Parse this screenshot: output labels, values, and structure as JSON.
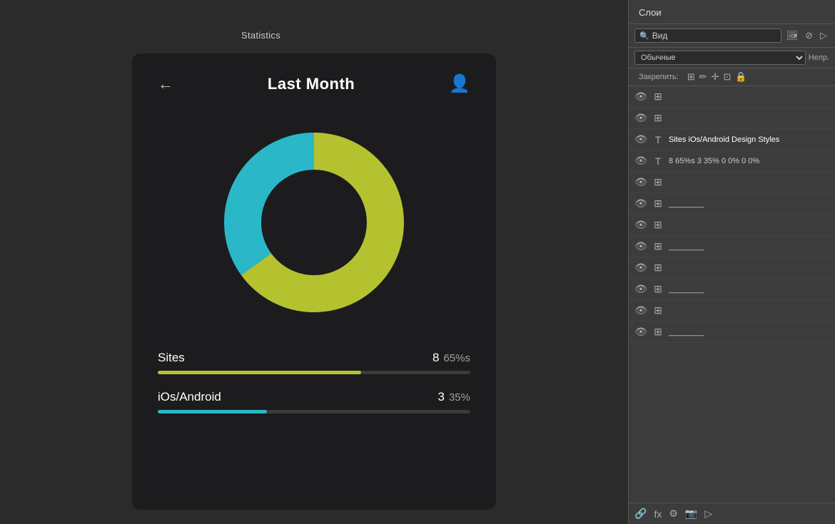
{
  "canvas": {
    "statistics_label": "Statistics"
  },
  "header": {
    "back_label": "←",
    "title": "Last Month",
    "user_icon": "👤"
  },
  "chart": {
    "yellow_percent": 65,
    "cyan_percent": 35,
    "yellow_color": "#b5c230",
    "cyan_color": "#2ab8c8"
  },
  "stats": [
    {
      "label": "Sites",
      "number": "8",
      "percent": "65%s",
      "fill_percent": 65,
      "color": "yellow"
    },
    {
      "label": "iOs/Android",
      "number": "3",
      "percent": "35%",
      "fill_percent": 35,
      "color": "cyan"
    }
  ],
  "layers_panel": {
    "title": "Слои",
    "search_placeholder": "Вид",
    "mode_value": "Обычные",
    "opacity_label": "Непр.",
    "lock_label": "Закрепить:",
    "layers": [
      {
        "has_eye": true,
        "has_thumb": true,
        "name": "",
        "type": "shape"
      },
      {
        "has_eye": true,
        "has_thumb": true,
        "name": "",
        "type": "shape"
      },
      {
        "has_eye": true,
        "has_thumb": true,
        "name": "Sites iOs/Android Design Styles",
        "type": "text"
      },
      {
        "has_eye": true,
        "has_thumb": true,
        "name": "8 65%s 3 35% 0 0% 0 0%",
        "type": "text"
      },
      {
        "has_eye": true,
        "has_thumb": true,
        "name": "",
        "type": "shape"
      },
      {
        "has_eye": true,
        "has_thumb": true,
        "name": "________",
        "type": "line"
      },
      {
        "has_eye": true,
        "has_thumb": true,
        "name": "",
        "type": "shape"
      },
      {
        "has_eye": true,
        "has_thumb": true,
        "name": "________",
        "type": "line"
      },
      {
        "has_eye": true,
        "has_thumb": true,
        "name": "",
        "type": "shape"
      },
      {
        "has_eye": true,
        "has_thumb": true,
        "name": "________",
        "type": "line"
      },
      {
        "has_eye": true,
        "has_thumb": true,
        "name": "",
        "type": "shape"
      },
      {
        "has_eye": true,
        "has_thumb": true,
        "name": "________",
        "type": "line"
      }
    ],
    "bottom_icons": [
      "🔗",
      "fx",
      "⚙",
      "📷",
      ""
    ]
  }
}
